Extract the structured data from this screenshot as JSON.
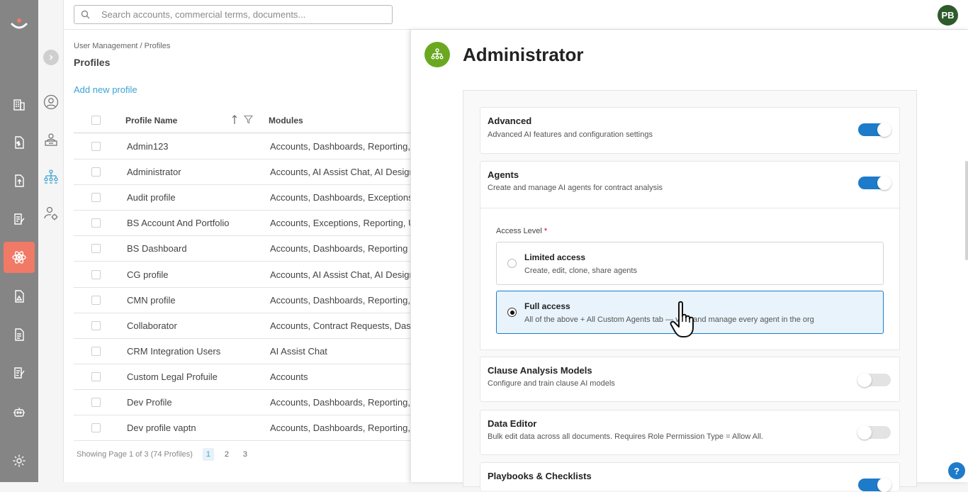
{
  "search": {
    "placeholder": "Search accounts, commercial terms, documents..."
  },
  "user": {
    "initials": "PB"
  },
  "breadcrumb": "User Management / Profiles",
  "page_title": "Profiles",
  "add_profile": "Add new profile",
  "table": {
    "col_name": "Profile Name",
    "col_modules": "Modules",
    "rows": [
      {
        "name": "Admin123",
        "modules": "Accounts, Dashboards, Reporting, Te"
      },
      {
        "name": "Administrator",
        "modules": "Accounts, AI Assist Chat, AI Design S"
      },
      {
        "name": "Audit profile",
        "modules": "Accounts, Dashboards, Exceptions, F"
      },
      {
        "name": "BS Account And Portfolio",
        "modules": "Accounts, Exceptions, Reporting, Us"
      },
      {
        "name": "BS Dashboard",
        "modules": "Accounts, Dashboards, Reporting"
      },
      {
        "name": "CG profile",
        "modules": "Accounts, AI Assist Chat, AI Design S"
      },
      {
        "name": "CMN profile",
        "modules": "Accounts, Dashboards, Reporting, U"
      },
      {
        "name": "Collaborator",
        "modules": "Accounts, Contract Requests, Dashb"
      },
      {
        "name": "CRM Integration Users",
        "modules": "AI Assist Chat"
      },
      {
        "name": "Custom Legal Profuile",
        "modules": "Accounts"
      },
      {
        "name": "Dev Profile",
        "modules": "Accounts, Dashboards, Reporting, Te"
      },
      {
        "name": "Dev profile vaptn",
        "modules": "Accounts, Dashboards, Reporting, Te"
      }
    ]
  },
  "pager": {
    "summary": "Showing Page 1 of 3 (74 Profiles)",
    "pages": [
      "1",
      "2",
      "3"
    ]
  },
  "drawer": {
    "title": "Administrator",
    "advanced": {
      "title": "Advanced",
      "desc": "Advanced AI features and configuration settings",
      "enabled": true
    },
    "agents": {
      "title": "Agents",
      "desc": "Create and manage AI agents for contract analysis",
      "enabled": true
    },
    "access_level": {
      "label": "Access Level",
      "required": "*"
    },
    "options": [
      {
        "title": "Limited access",
        "desc": "Create, edit, clone, share agents",
        "selected": false
      },
      {
        "title": "Full access",
        "desc": "All of the above + All Custom Agents tab — view and manage every agent in the org",
        "selected": true
      }
    ],
    "clause": {
      "title": "Clause Analysis Models",
      "desc": "Configure and train clause AI models",
      "enabled": false
    },
    "data_editor": {
      "title": "Data Editor",
      "desc": "Bulk edit data across all documents. Requires Role Permission Type = Allow All.",
      "enabled": false
    },
    "playbooks": {
      "title": "Playbooks & Checklists",
      "enabled": true
    }
  },
  "help": "?",
  "colors": {
    "accent": "#1e7bc9",
    "active_nav": "#f17a66",
    "profile_icon": "#6aa821",
    "avatar": "#2e5b2b"
  }
}
